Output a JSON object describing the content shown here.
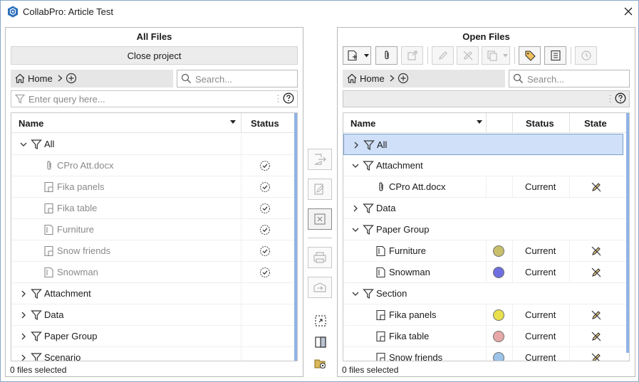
{
  "window": {
    "title": "CollabPro: Article Test"
  },
  "left": {
    "title": "All Files",
    "close_project": "Close project",
    "breadcrumb": {
      "home": "Home"
    },
    "search": {
      "placeholder": "Search..."
    },
    "query": {
      "placeholder": "Enter query here...",
      "dots": "⋮"
    },
    "columns": {
      "name": "Name",
      "status": "Status"
    },
    "rows": [
      {
        "label": "All",
        "expanded": true,
        "type": "filter"
      },
      {
        "label": "CPro Att.docx",
        "type": "attachment",
        "muted": true
      },
      {
        "label": "Fika panels",
        "type": "panel",
        "muted": true
      },
      {
        "label": "Fika table",
        "type": "panel",
        "muted": true
      },
      {
        "label": "Furniture",
        "type": "page",
        "muted": true
      },
      {
        "label": "Snow friends",
        "type": "panel",
        "muted": true
      },
      {
        "label": "Snowman",
        "type": "page",
        "muted": true
      },
      {
        "label": "Attachment",
        "expanded": false,
        "type": "filter"
      },
      {
        "label": "Data",
        "expanded": false,
        "type": "filter"
      },
      {
        "label": "Paper Group",
        "expanded": false,
        "type": "filter"
      },
      {
        "label": "Scenario",
        "expanded": false,
        "type": "filter"
      }
    ],
    "footer": "0 files selected"
  },
  "right": {
    "title": "Open Files",
    "breadcrumb": {
      "home": "Home"
    },
    "search": {
      "placeholder": "Search..."
    },
    "query": {
      "dots": "⋮"
    },
    "columns": {
      "name": "Name",
      "status": "Status",
      "state": "State"
    },
    "rows": [
      {
        "label": "All",
        "type": "filter",
        "expanded": false,
        "selected": true
      },
      {
        "label": "Attachment",
        "type": "filter",
        "expanded": true
      },
      {
        "label": "CPro Att.docx",
        "type": "attachment",
        "status": "Current"
      },
      {
        "label": "Data",
        "type": "filter",
        "expanded": false
      },
      {
        "label": "Paper Group",
        "type": "filter",
        "expanded": true
      },
      {
        "label": "Furniture",
        "type": "page",
        "status": "Current",
        "color": "#c8bf6a"
      },
      {
        "label": "Snowman",
        "type": "page",
        "status": "Current",
        "color": "#6f6fe0"
      },
      {
        "label": "Section",
        "type": "filter",
        "expanded": true
      },
      {
        "label": "Fika panels",
        "type": "panel",
        "status": "Current",
        "color": "#e8e04c"
      },
      {
        "label": "Fika table",
        "type": "panel",
        "status": "Current",
        "color": "#e8a8a8"
      },
      {
        "label": "Snow friends",
        "type": "panel",
        "status": "Current",
        "color": "#9cc4e8"
      }
    ],
    "footer": "0 files selected"
  },
  "colors": {
    "accent": "#2a6ebb",
    "selection": "#cfe0f8",
    "scrollbar": "#8fb3e6"
  }
}
